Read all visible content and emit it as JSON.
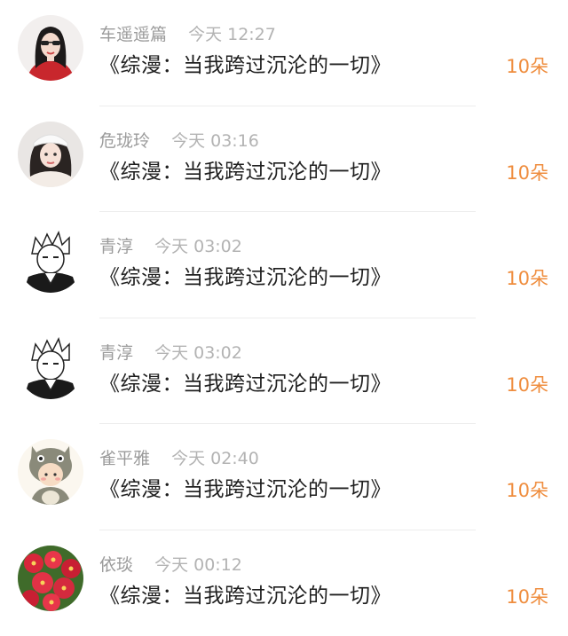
{
  "list": {
    "items": [
      {
        "username": "车遥遥篇",
        "time": "今天 12:27",
        "message": "《综漫：当我跨过沉沦的一切》",
        "amount": "10朵",
        "avatar_icon": "woman-red-dress-avatar-icon"
      },
      {
        "username": "危珑玲",
        "time": "今天 03:16",
        "message": "《综漫：当我跨过沉沦的一切》",
        "amount": "10朵",
        "avatar_icon": "woman-white-cap-avatar-icon"
      },
      {
        "username": "青淳",
        "time": "今天 03:02",
        "message": "《综漫：当我跨过沉沦的一切》",
        "amount": "10朵",
        "avatar_icon": "manga-boy-avatar-icon"
      },
      {
        "username": "青淳",
        "time": "今天 03:02",
        "message": "《综漫：当我跨过沉沦的一切》",
        "amount": "10朵",
        "avatar_icon": "manga-boy-avatar-icon"
      },
      {
        "username": "雀平雅",
        "time": "今天 02:40",
        "message": "《综漫：当我跨过沉沦的一切》",
        "amount": "10朵",
        "avatar_icon": "totoro-costume-kid-avatar-icon"
      },
      {
        "username": "依琰",
        "time": "今天 00:12",
        "message": "《综漫：当我跨过沉沦的一切》",
        "amount": "10朵",
        "avatar_icon": "red-flowers-avatar-icon"
      }
    ]
  },
  "colors": {
    "amount": "#ef8d3e",
    "username": "#9b9b9b",
    "time": "#b3b3b3",
    "message": "#1f1f1f",
    "divider": "#ededed"
  }
}
